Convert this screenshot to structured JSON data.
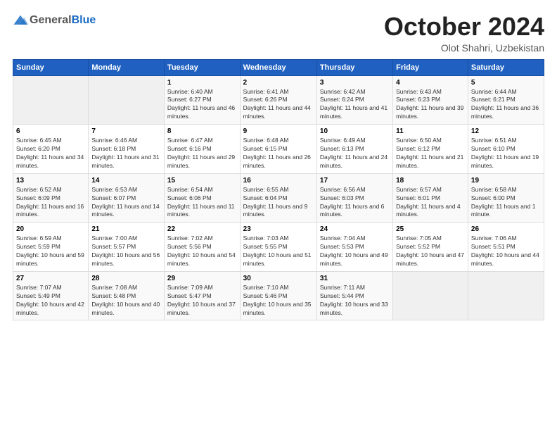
{
  "logo": {
    "general": "General",
    "blue": "Blue"
  },
  "header": {
    "month": "October 2024",
    "subtitle": "Olot Shahri, Uzbekistan"
  },
  "weekdays": [
    "Sunday",
    "Monday",
    "Tuesday",
    "Wednesday",
    "Thursday",
    "Friday",
    "Saturday"
  ],
  "weeks": [
    [
      {
        "day": "",
        "sunrise": "",
        "sunset": "",
        "daylight": ""
      },
      {
        "day": "",
        "sunrise": "",
        "sunset": "",
        "daylight": ""
      },
      {
        "day": "1",
        "sunrise": "Sunrise: 6:40 AM",
        "sunset": "Sunset: 6:27 PM",
        "daylight": "Daylight: 11 hours and 46 minutes."
      },
      {
        "day": "2",
        "sunrise": "Sunrise: 6:41 AM",
        "sunset": "Sunset: 6:26 PM",
        "daylight": "Daylight: 11 hours and 44 minutes."
      },
      {
        "day": "3",
        "sunrise": "Sunrise: 6:42 AM",
        "sunset": "Sunset: 6:24 PM",
        "daylight": "Daylight: 11 hours and 41 minutes."
      },
      {
        "day": "4",
        "sunrise": "Sunrise: 6:43 AM",
        "sunset": "Sunset: 6:23 PM",
        "daylight": "Daylight: 11 hours and 39 minutes."
      },
      {
        "day": "5",
        "sunrise": "Sunrise: 6:44 AM",
        "sunset": "Sunset: 6:21 PM",
        "daylight": "Daylight: 11 hours and 36 minutes."
      }
    ],
    [
      {
        "day": "6",
        "sunrise": "Sunrise: 6:45 AM",
        "sunset": "Sunset: 6:20 PM",
        "daylight": "Daylight: 11 hours and 34 minutes."
      },
      {
        "day": "7",
        "sunrise": "Sunrise: 6:46 AM",
        "sunset": "Sunset: 6:18 PM",
        "daylight": "Daylight: 11 hours and 31 minutes."
      },
      {
        "day": "8",
        "sunrise": "Sunrise: 6:47 AM",
        "sunset": "Sunset: 6:16 PM",
        "daylight": "Daylight: 11 hours and 29 minutes."
      },
      {
        "day": "9",
        "sunrise": "Sunrise: 6:48 AM",
        "sunset": "Sunset: 6:15 PM",
        "daylight": "Daylight: 11 hours and 26 minutes."
      },
      {
        "day": "10",
        "sunrise": "Sunrise: 6:49 AM",
        "sunset": "Sunset: 6:13 PM",
        "daylight": "Daylight: 11 hours and 24 minutes."
      },
      {
        "day": "11",
        "sunrise": "Sunrise: 6:50 AM",
        "sunset": "Sunset: 6:12 PM",
        "daylight": "Daylight: 11 hours and 21 minutes."
      },
      {
        "day": "12",
        "sunrise": "Sunrise: 6:51 AM",
        "sunset": "Sunset: 6:10 PM",
        "daylight": "Daylight: 11 hours and 19 minutes."
      }
    ],
    [
      {
        "day": "13",
        "sunrise": "Sunrise: 6:52 AM",
        "sunset": "Sunset: 6:09 PM",
        "daylight": "Daylight: 11 hours and 16 minutes."
      },
      {
        "day": "14",
        "sunrise": "Sunrise: 6:53 AM",
        "sunset": "Sunset: 6:07 PM",
        "daylight": "Daylight: 11 hours and 14 minutes."
      },
      {
        "day": "15",
        "sunrise": "Sunrise: 6:54 AM",
        "sunset": "Sunset: 6:06 PM",
        "daylight": "Daylight: 11 hours and 11 minutes."
      },
      {
        "day": "16",
        "sunrise": "Sunrise: 6:55 AM",
        "sunset": "Sunset: 6:04 PM",
        "daylight": "Daylight: 11 hours and 9 minutes."
      },
      {
        "day": "17",
        "sunrise": "Sunrise: 6:56 AM",
        "sunset": "Sunset: 6:03 PM",
        "daylight": "Daylight: 11 hours and 6 minutes."
      },
      {
        "day": "18",
        "sunrise": "Sunrise: 6:57 AM",
        "sunset": "Sunset: 6:01 PM",
        "daylight": "Daylight: 11 hours and 4 minutes."
      },
      {
        "day": "19",
        "sunrise": "Sunrise: 6:58 AM",
        "sunset": "Sunset: 6:00 PM",
        "daylight": "Daylight: 11 hours and 1 minute."
      }
    ],
    [
      {
        "day": "20",
        "sunrise": "Sunrise: 6:59 AM",
        "sunset": "Sunset: 5:59 PM",
        "daylight": "Daylight: 10 hours and 59 minutes."
      },
      {
        "day": "21",
        "sunrise": "Sunrise: 7:00 AM",
        "sunset": "Sunset: 5:57 PM",
        "daylight": "Daylight: 10 hours and 56 minutes."
      },
      {
        "day": "22",
        "sunrise": "Sunrise: 7:02 AM",
        "sunset": "Sunset: 5:56 PM",
        "daylight": "Daylight: 10 hours and 54 minutes."
      },
      {
        "day": "23",
        "sunrise": "Sunrise: 7:03 AM",
        "sunset": "Sunset: 5:55 PM",
        "daylight": "Daylight: 10 hours and 51 minutes."
      },
      {
        "day": "24",
        "sunrise": "Sunrise: 7:04 AM",
        "sunset": "Sunset: 5:53 PM",
        "daylight": "Daylight: 10 hours and 49 minutes."
      },
      {
        "day": "25",
        "sunrise": "Sunrise: 7:05 AM",
        "sunset": "Sunset: 5:52 PM",
        "daylight": "Daylight: 10 hours and 47 minutes."
      },
      {
        "day": "26",
        "sunrise": "Sunrise: 7:06 AM",
        "sunset": "Sunset: 5:51 PM",
        "daylight": "Daylight: 10 hours and 44 minutes."
      }
    ],
    [
      {
        "day": "27",
        "sunrise": "Sunrise: 7:07 AM",
        "sunset": "Sunset: 5:49 PM",
        "daylight": "Daylight: 10 hours and 42 minutes."
      },
      {
        "day": "28",
        "sunrise": "Sunrise: 7:08 AM",
        "sunset": "Sunset: 5:48 PM",
        "daylight": "Daylight: 10 hours and 40 minutes."
      },
      {
        "day": "29",
        "sunrise": "Sunrise: 7:09 AM",
        "sunset": "Sunset: 5:47 PM",
        "daylight": "Daylight: 10 hours and 37 minutes."
      },
      {
        "day": "30",
        "sunrise": "Sunrise: 7:10 AM",
        "sunset": "Sunset: 5:46 PM",
        "daylight": "Daylight: 10 hours and 35 minutes."
      },
      {
        "day": "31",
        "sunrise": "Sunrise: 7:11 AM",
        "sunset": "Sunset: 5:44 PM",
        "daylight": "Daylight: 10 hours and 33 minutes."
      },
      {
        "day": "",
        "sunrise": "",
        "sunset": "",
        "daylight": ""
      },
      {
        "day": "",
        "sunrise": "",
        "sunset": "",
        "daylight": ""
      }
    ]
  ]
}
